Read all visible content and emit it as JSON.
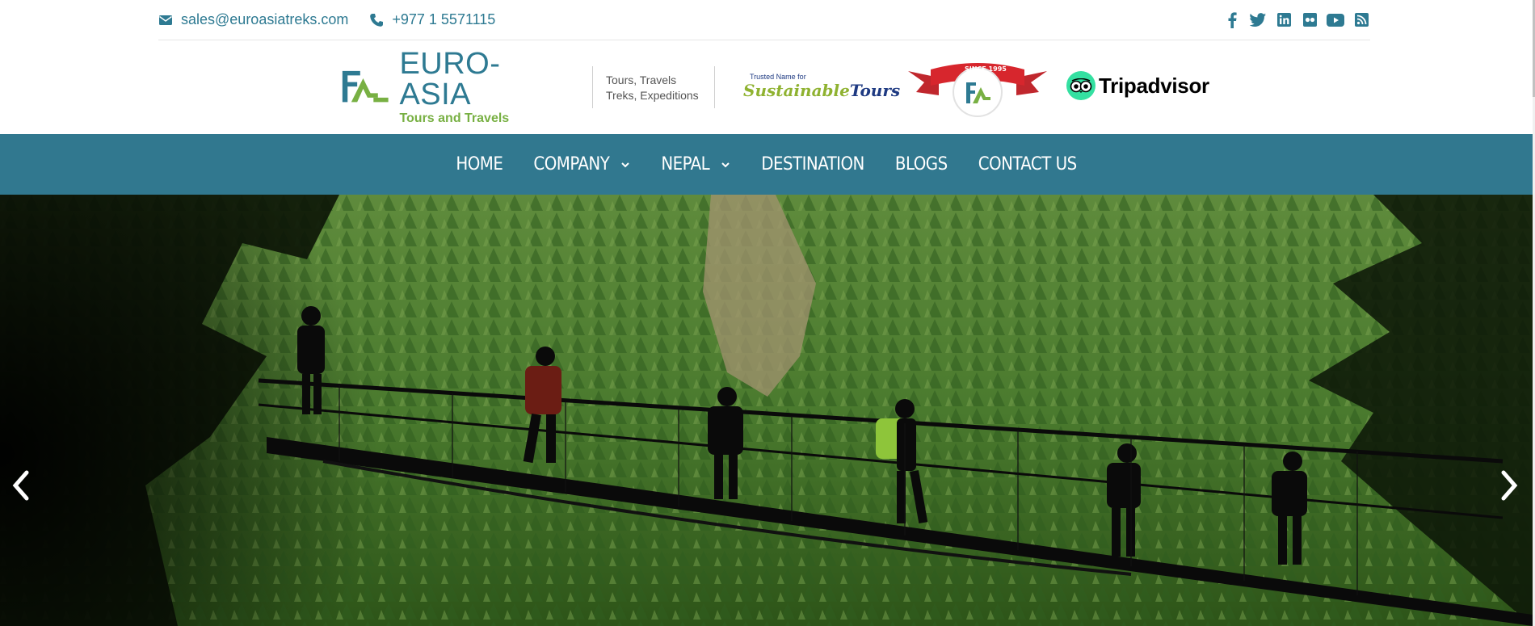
{
  "topbar": {
    "email": "sales@euroasiatreks.com",
    "phone": "+977 1 5571115",
    "socials": [
      {
        "icon": "facebook-icon"
      },
      {
        "icon": "twitter-icon"
      },
      {
        "icon": "linkedin-icon"
      },
      {
        "icon": "flickr-icon"
      },
      {
        "icon": "youtube-icon"
      },
      {
        "icon": "rss-icon"
      }
    ]
  },
  "header": {
    "logo_name": "EURO-ASIA",
    "logo_sub": "Tours and Travels",
    "tagline_line1": "Tours, Travels",
    "tagline_line2": "Treks, Expeditions",
    "sustainable_small": "Trusted Name for",
    "sustainable_word1": "Sustainable",
    "sustainable_word2": "Tours",
    "since_text": "SINCE 1995",
    "tripadvisor": "Tripadvisor"
  },
  "nav": {
    "items": [
      {
        "label": "HOME",
        "dropdown": false
      },
      {
        "label": "COMPANY",
        "dropdown": true
      },
      {
        "label": "NEPAL",
        "dropdown": true
      },
      {
        "label": "DESTINATION",
        "dropdown": false
      },
      {
        "label": "BLOGS",
        "dropdown": false
      },
      {
        "label": "CONTACT US",
        "dropdown": false
      }
    ]
  },
  "colors": {
    "brand_teal": "#31788f",
    "brand_green": "#78b043",
    "text_teal": "#2e7a92",
    "tripadvisor_green": "#34e0a1"
  },
  "hero": {
    "prev_icon": "chevron-left-icon",
    "next_icon": "chevron-right-icon"
  }
}
